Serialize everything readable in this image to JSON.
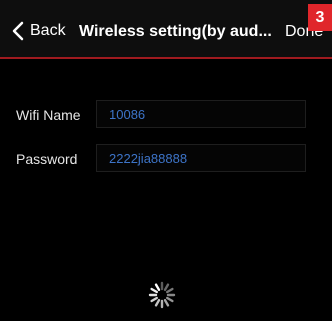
{
  "nav": {
    "back_label": "Back",
    "title": "Wireless setting(by aud...",
    "done_label": "Done"
  },
  "badge": {
    "step": "3",
    "color": "#e0262b"
  },
  "form": {
    "wifi_name": {
      "label": "Wifi Name",
      "value": "10086"
    },
    "password": {
      "label": "Password",
      "value": "2222jia88888"
    }
  },
  "status": {
    "loading": true
  },
  "colors": {
    "background": "#000000",
    "accent_line": "#a01a1f",
    "input_text": "#3d74c8"
  },
  "icons": {
    "back": "chevron-left-icon",
    "loading": "spinner-icon"
  }
}
